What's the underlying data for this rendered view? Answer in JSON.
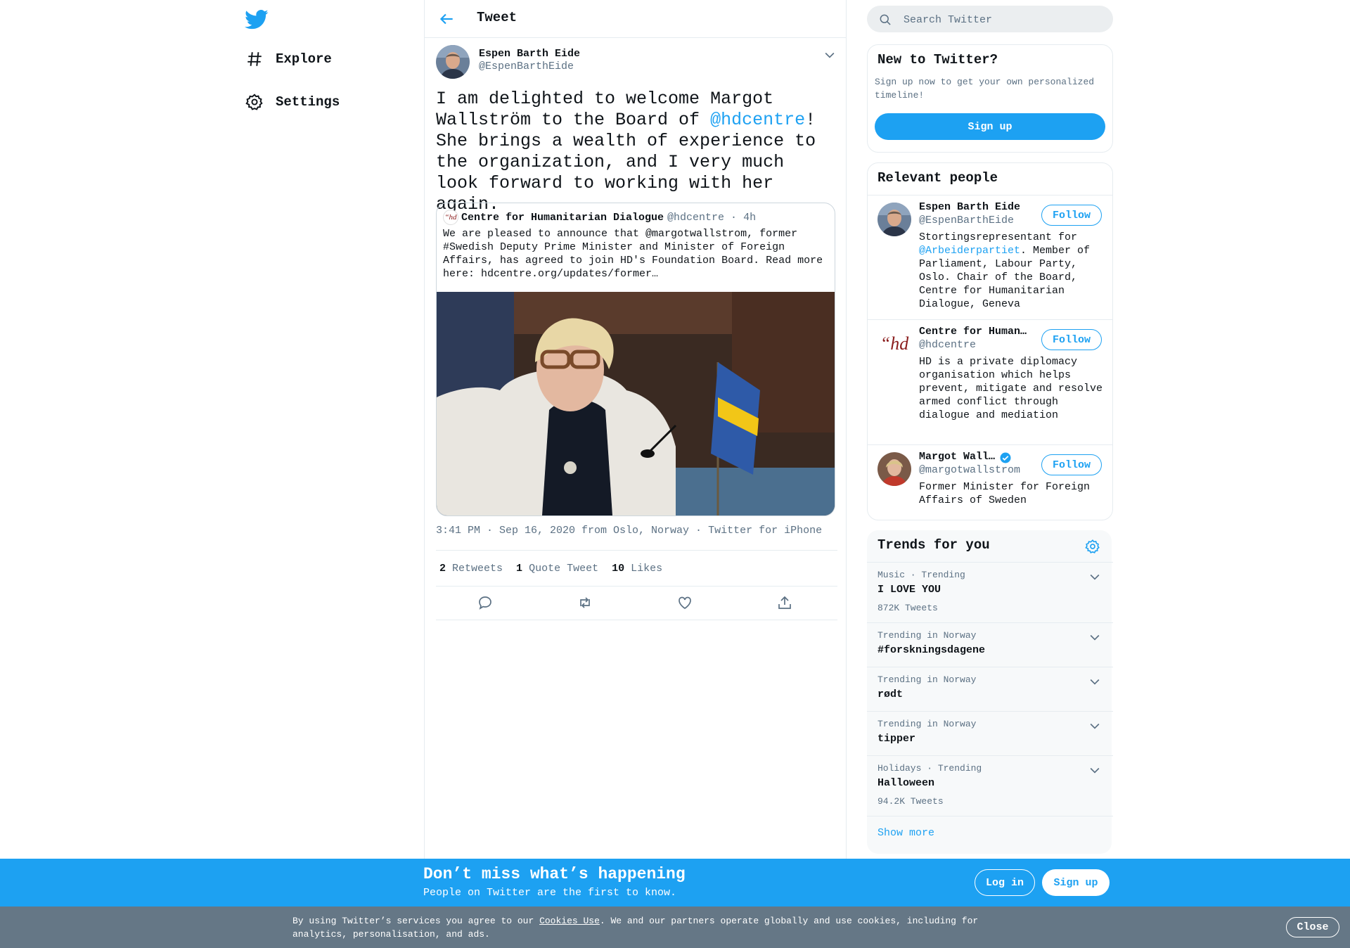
{
  "nav": {
    "items": [
      {
        "label": "Explore",
        "icon": "hashtag-icon"
      },
      {
        "label": "Settings",
        "icon": "gear-icon"
      }
    ]
  },
  "header": {
    "title": "Tweet"
  },
  "tweet": {
    "author_name": "Espen Barth Eide",
    "author_handle": "@EspenBarthEide",
    "text_before": "I am delighted to welcome Margot Wallström to the Board of ",
    "mention": "@hdcentre",
    "text_after": "! She brings a wealth of experience to the organization, and I very much look forward to working with her again.",
    "meta": "3:41 PM · Sep 16, 2020 from Oslo, Norway · Twitter for iPhone",
    "retweets_count": "2",
    "retweets_label": "Retweets",
    "quotes_count": "1",
    "quotes_label": "Quote Tweet",
    "likes_count": "10",
    "likes_label": "Likes"
  },
  "quote": {
    "logo_text": "“hd",
    "name": "Centre for Humanitarian Dialogue",
    "handle_time": "@hdcentre · 4h",
    "text": "We are pleased to announce that @margotwallstrom, former #Swedish Deputy Prime Minister and Minister of Foreign Affairs, has agreed to join HD's Foundation Board. Read more here: hdcentre.org/updates/former…"
  },
  "search": {
    "placeholder": "Search Twitter"
  },
  "new_to_twitter": {
    "title": "New to Twitter?",
    "subtitle": "Sign up now to get your own personalized timeline!",
    "signup_label": "Sign up"
  },
  "relevant_people": {
    "title": "Relevant people",
    "follow_label": "Follow",
    "people": [
      {
        "name": "Espen Barth Eide",
        "handle": "@EspenBarthEide",
        "bio_before": "Stortingsrepresentant for ",
        "bio_mention": "@Arbeiderpartiet",
        "bio_after": ". Member of Parliament, Labour Party, Oslo. Chair of the Board, Centre for Humanitarian Dialogue, Geneva"
      },
      {
        "name": "Centre for Humani…",
        "handle": "@hdcentre",
        "logo_text": "“hd",
        "bio": "HD is a private diplomacy organisation which helps prevent, mitigate and resolve armed conflict through dialogue and mediation"
      },
      {
        "name": "Margot Wallstr…",
        "handle": "@margotwallstrom",
        "verified": true,
        "bio": "Former Minister for Foreign Affairs of Sweden"
      }
    ]
  },
  "trends": {
    "title": "Trends for you",
    "items": [
      {
        "meta": "Music · Trending",
        "name": "I LOVE YOU",
        "count": "872K Tweets"
      },
      {
        "meta": "Trending in Norway",
        "name": "#forskningsdagene",
        "count": ""
      },
      {
        "meta": "Trending in Norway",
        "name": "rødt",
        "count": ""
      },
      {
        "meta": "Trending in Norway",
        "name": "tipper",
        "count": ""
      },
      {
        "meta": "Holidays · Trending",
        "name": "Halloween",
        "count": "94.2K Tweets"
      }
    ],
    "show_more": "Show more"
  },
  "bottom_bar": {
    "title": "Don’t miss what’s happening",
    "subtitle": "People on Twitter are the first to know.",
    "login_label": "Log in",
    "signup_label": "Sign up"
  },
  "cookie_bar": {
    "text_before": "By using Twitter’s services you agree to our ",
    "link": "Cookies Use",
    "text_after": ". We and our partners operate globally and use cookies, including for analytics, personalisation, and ads.",
    "close_label": "Close"
  },
  "colors": {
    "accent": "#1da1f2",
    "cookie_bg": "#657786",
    "muted": "#5b7083"
  }
}
